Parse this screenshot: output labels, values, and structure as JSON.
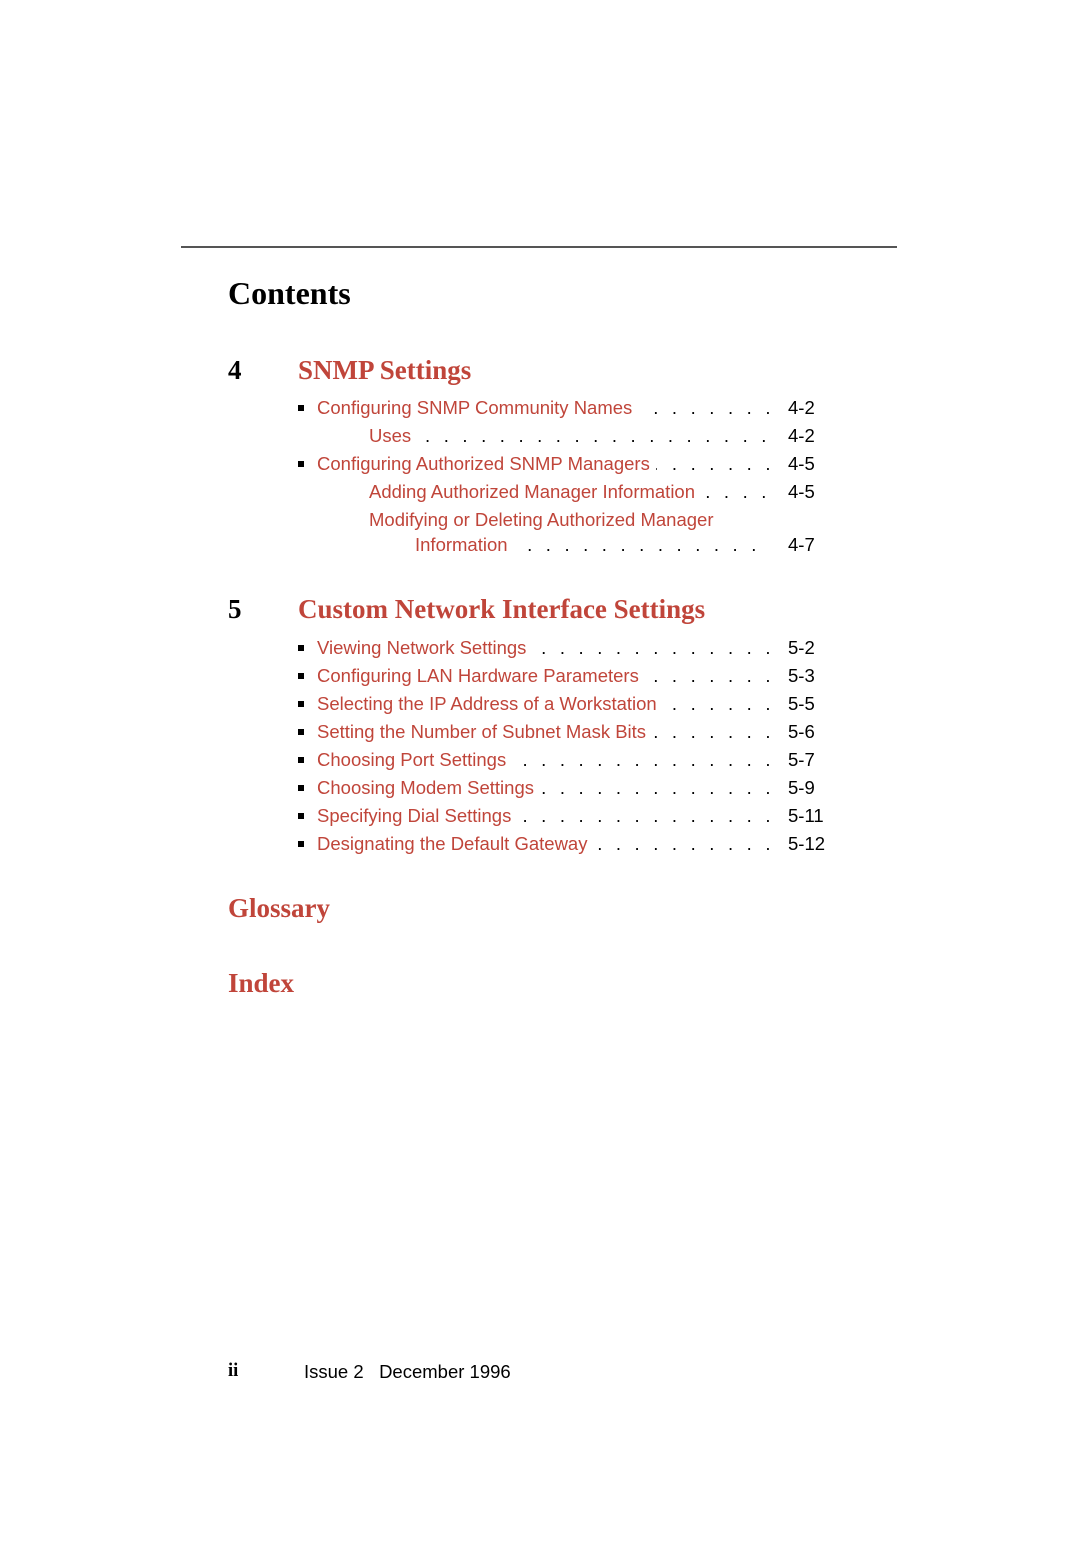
{
  "page_title": "Contents",
  "chapters": [
    {
      "number": "4",
      "title": "SNMP Settings",
      "entries": [
        {
          "label": "Configuring SNMP Community Names",
          "page": "4-2",
          "level": 1
        },
        {
          "label": "Uses",
          "page": "4-2",
          "level": 2
        },
        {
          "label": "Configuring Authorized SNMP Managers",
          "page": "4-5",
          "level": 1
        },
        {
          "label": "Adding Authorized Manager Information",
          "page": "4-5",
          "level": 2
        },
        {
          "label": "Modifying or Deleting Authorized Manager",
          "label_cont": "Information",
          "page": "4-7",
          "level": 2
        }
      ]
    },
    {
      "number": "5",
      "title": "Custom Network Interface Settings",
      "entries": [
        {
          "label": "Viewing Network Settings",
          "page": "5-2",
          "level": 1
        },
        {
          "label": "Configuring LAN Hardware Parameters",
          "page": "5-3",
          "level": 1
        },
        {
          "label": "Selecting the IP Address of a Workstation",
          "page": "5-5",
          "level": 1
        },
        {
          "label": "Setting the Number of Subnet Mask Bits",
          "page": "5-6",
          "level": 1
        },
        {
          "label": "Choosing Port Settings",
          "page": "5-7",
          "level": 1
        },
        {
          "label": "Choosing Modem Settings",
          "page": "5-9",
          "level": 1
        },
        {
          "label": "Specifying Dial Settings",
          "page": "5-11",
          "level": 1
        },
        {
          "label": "Designating the Default Gateway",
          "page": "5-12",
          "level": 1
        }
      ]
    }
  ],
  "back_matter": [
    "Glossary",
    "Index"
  ],
  "footer": {
    "page_number": "ii",
    "issue": "Issue 2   December 1996"
  },
  "colors": {
    "link": "#c0453a",
    "text": "#000000"
  }
}
